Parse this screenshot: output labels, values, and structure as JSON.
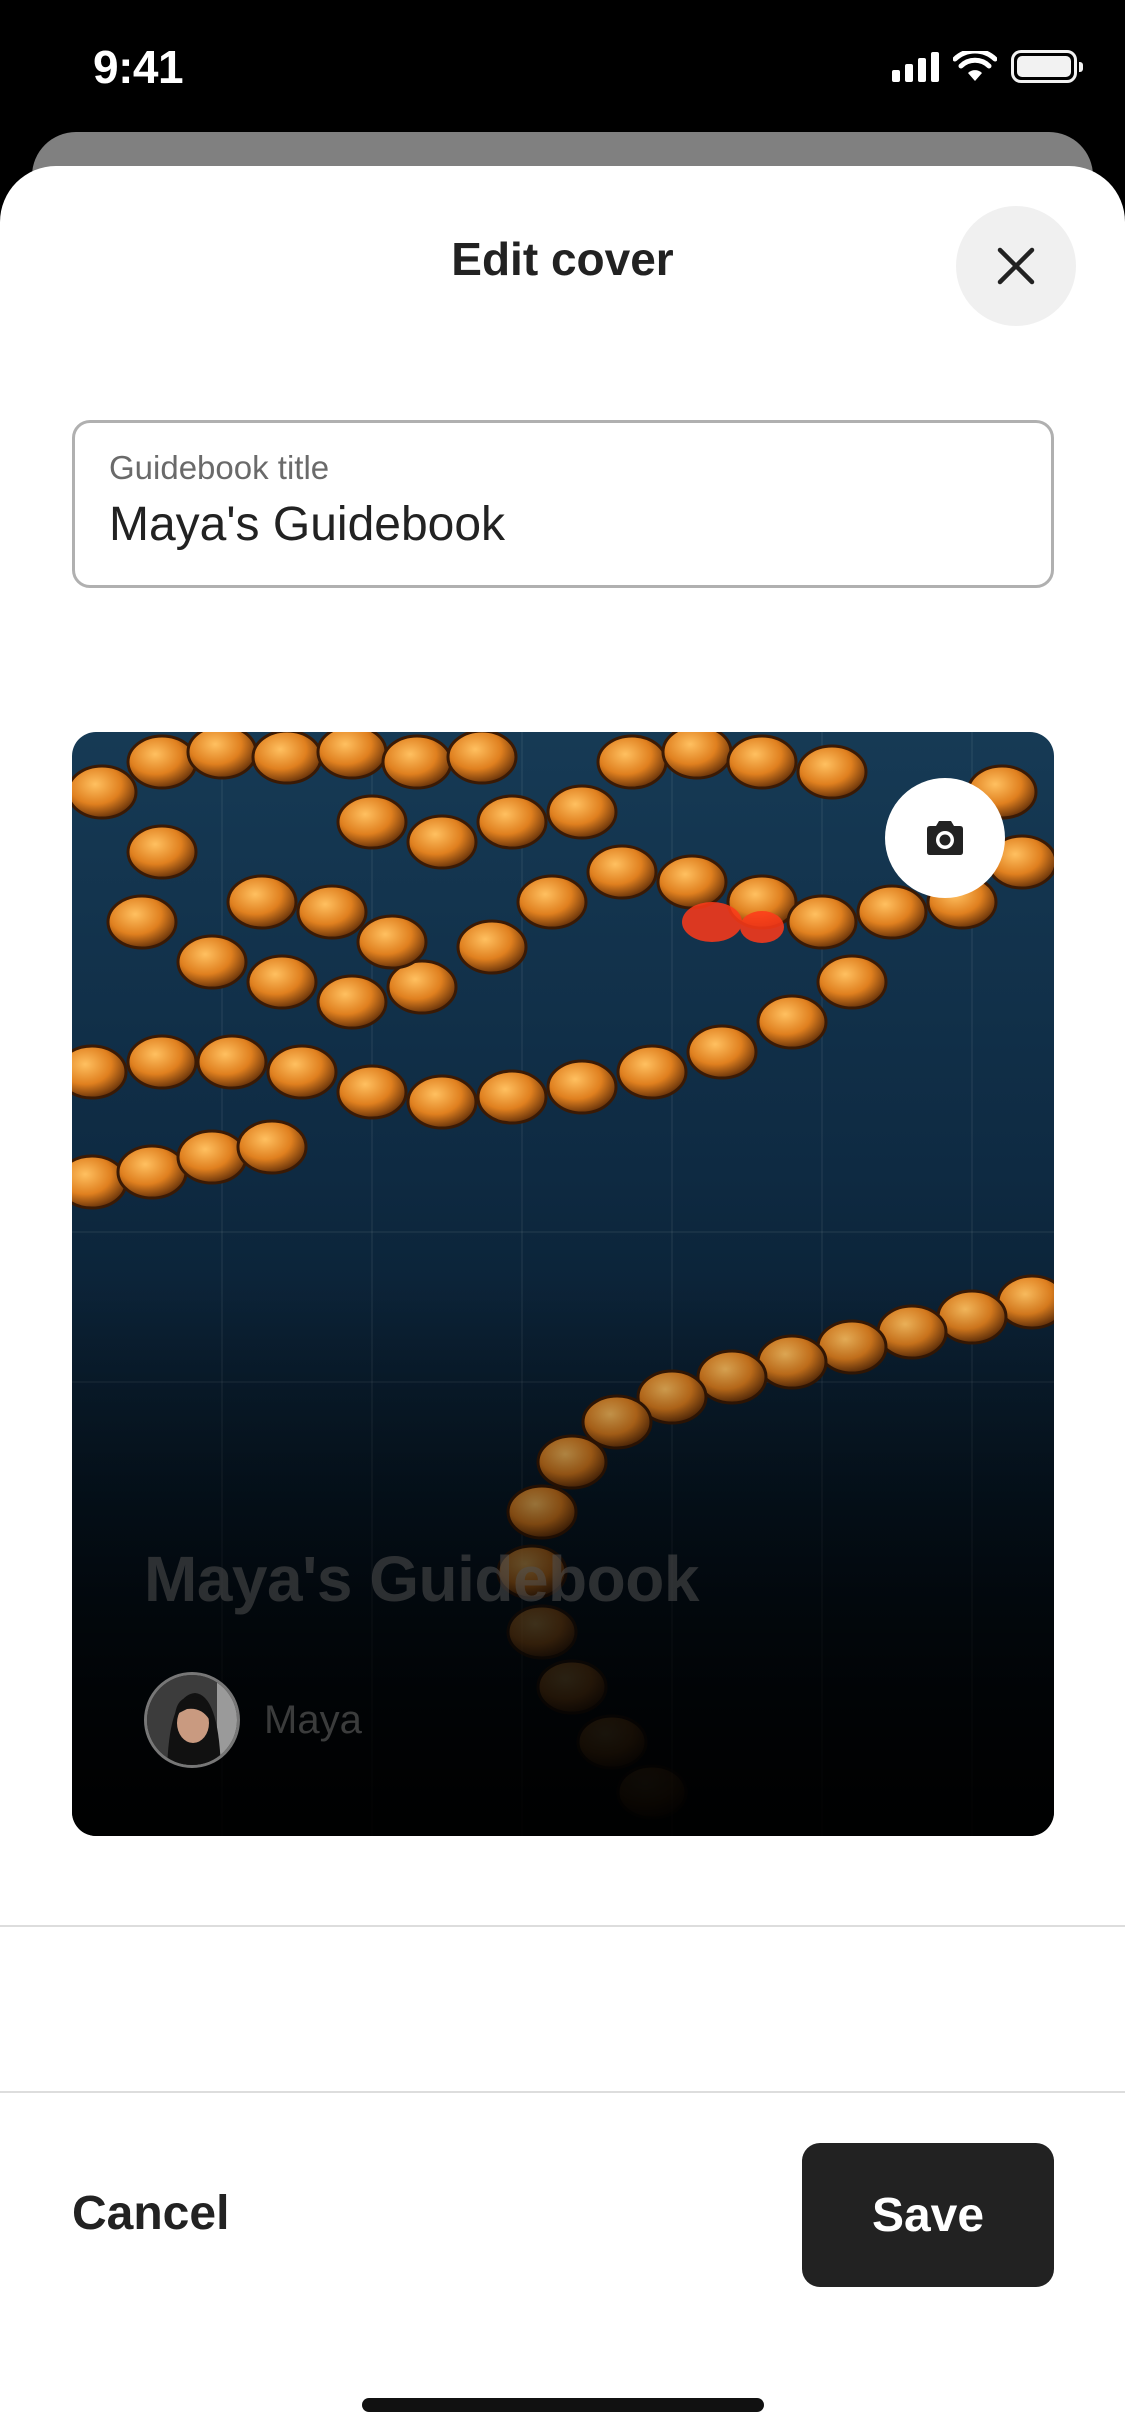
{
  "status_bar": {
    "time": "9:41",
    "icons": [
      "cellular-signal-icon",
      "wifi-icon",
      "battery-icon"
    ]
  },
  "sheet": {
    "title": "Edit cover",
    "close_icon": "close-icon"
  },
  "title_field": {
    "label": "Guidebook title",
    "value": "Maya's Guidebook"
  },
  "cover": {
    "camera_icon": "camera-icon",
    "title": "Maya's Guidebook",
    "author": "Maya"
  },
  "footer": {
    "cancel_label": "Cancel",
    "save_label": "Save"
  },
  "colors": {
    "primary_button": "#222222",
    "text": "#222222",
    "cover_bead": "#e8902a"
  }
}
